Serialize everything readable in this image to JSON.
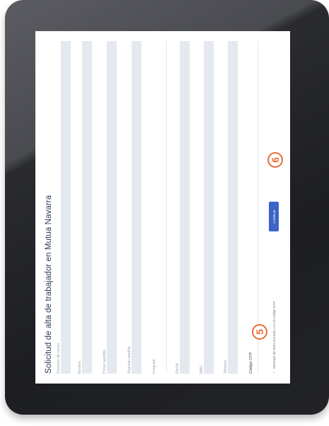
{
  "form": {
    "title": "Solicitud de alta de trabajador en Mutua Navarra",
    "fields": [
      {
        "label": "Dirección de correo"
      },
      {
        "label": "Nombre"
      },
      {
        "label": "Primer apellido"
      },
      {
        "label": "Segundo apellido"
      },
      {
        "label": "Lenguaje"
      },
      {
        "label": "Doc/Id"
      },
      {
        "label": "NAVI"
      },
      {
        "label": "Teléfono"
      }
    ],
    "code_label": "Código OTP",
    "otp_message": "Mensaje de SMS enviado con el código OTP",
    "otp_check_icon": "✓",
    "continue_label": "Continuar"
  },
  "annotations": {
    "step_5": "5",
    "step_6": "6",
    "color": "#e86a3a"
  },
  "colors": {
    "bezel": "#1d1e22",
    "input_fill": "#e4e8ef",
    "button": "#3d63c7",
    "title": "#2b3a55"
  }
}
